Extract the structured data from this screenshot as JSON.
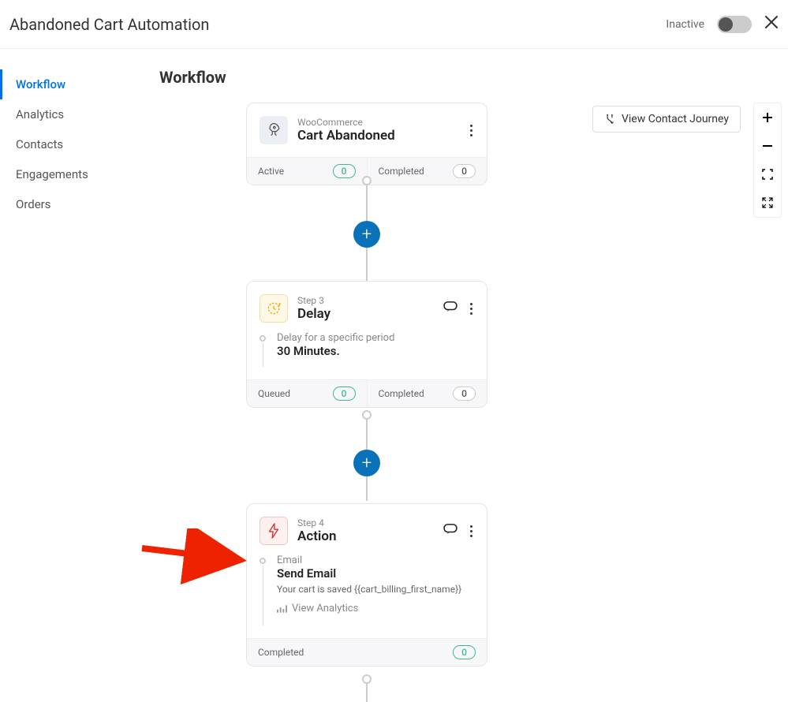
{
  "header": {
    "title": "Abandoned Cart Automation",
    "status_label": "Inactive"
  },
  "sidebar": {
    "items": [
      {
        "label": "Workflow",
        "active": true
      },
      {
        "label": "Analytics",
        "active": false
      },
      {
        "label": "Contacts",
        "active": false
      },
      {
        "label": "Engagements",
        "active": false
      },
      {
        "label": "Orders",
        "active": false
      }
    ]
  },
  "section": {
    "title": "Workflow"
  },
  "journey_button": "View Contact Journey",
  "nodes": {
    "trigger": {
      "sup": "WooCommerce",
      "title": "Cart Abandoned",
      "footer": {
        "left_label": "Active",
        "left_count": "0",
        "right_label": "Completed",
        "right_count": "0"
      }
    },
    "delay": {
      "sup": "Step 3",
      "title": "Delay",
      "body_l1": "Delay for a specific period",
      "body_l2": "30 Minutes.",
      "footer": {
        "left_label": "Queued",
        "left_count": "0",
        "right_label": "Completed",
        "right_count": "0"
      }
    },
    "action": {
      "sup": "Step 4",
      "title": "Action",
      "body_l1": "Email",
      "body_l2": "Send Email",
      "body_l3": "Your cart is saved {{cart_billing_first_name}}",
      "analytics": "View Analytics",
      "footer": {
        "label": "Completed",
        "count": "0"
      }
    }
  }
}
